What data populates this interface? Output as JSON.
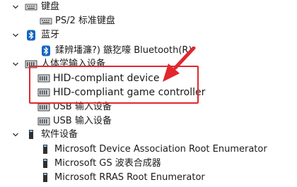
{
  "tree": {
    "keyboards": {
      "label": "键盘",
      "children": [
        {
          "label": "PS/2 标准键盘"
        }
      ]
    },
    "bluetooth": {
      "label": "蓝牙",
      "children": [
        {
          "label": "鍒辨墦濂?) 鏃犵嚎 Bluetooth(R)"
        }
      ]
    },
    "hid": {
      "label": "人体学输入设备",
      "children": [
        {
          "label": "HID-compliant device"
        },
        {
          "label": "HID-compliant game controller"
        },
        {
          "label": "USB 输入设备"
        },
        {
          "label": "USB 输入设备"
        }
      ]
    },
    "software": {
      "label": "软件设备",
      "children": [
        {
          "label": "Microsoft Device Association Root Enumerator"
        },
        {
          "label": "Microsoft GS 波表合成器"
        },
        {
          "label": "Microsoft RRAS Root Enumerator"
        }
      ]
    }
  },
  "annotation": {
    "color": "#e0282e"
  }
}
